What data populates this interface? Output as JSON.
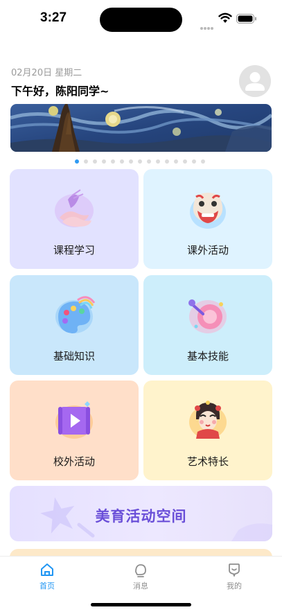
{
  "status_bar": {
    "time": "3:27"
  },
  "header": {
    "date": "02月20日  星期二",
    "greeting": "下午好，陈阳同学~"
  },
  "banner": {
    "slide_count": 15,
    "active_index": 0
  },
  "cards": [
    {
      "label": "课程学习",
      "icon": "ballet-shoes-icon",
      "bg": "#e2e2ff"
    },
    {
      "label": "课外活动",
      "icon": "lion-dance-icon",
      "bg": "#dff3ff"
    },
    {
      "label": "基础知识",
      "icon": "paint-palette-icon",
      "bg": "#c9e7fb"
    },
    {
      "label": "基本技能",
      "icon": "music-instrument-icon",
      "bg": "#cdeefb"
    },
    {
      "label": "校外活动",
      "icon": "video-play-icon",
      "bg": "#ffdfc9"
    },
    {
      "label": "艺术特长",
      "icon": "opera-mask-icon",
      "bg": "#fff3cc"
    }
  ],
  "promo": {
    "title": "美育活动空间"
  },
  "tabbar": {
    "items": [
      {
        "label": "首页",
        "icon": "home-icon",
        "active": true
      },
      {
        "label": "消息",
        "icon": "message-icon",
        "active": false
      },
      {
        "label": "我的",
        "icon": "profile-icon",
        "active": false
      }
    ]
  },
  "colors": {
    "accent": "#2196f3",
    "promo_text": "#6a4fd8"
  }
}
